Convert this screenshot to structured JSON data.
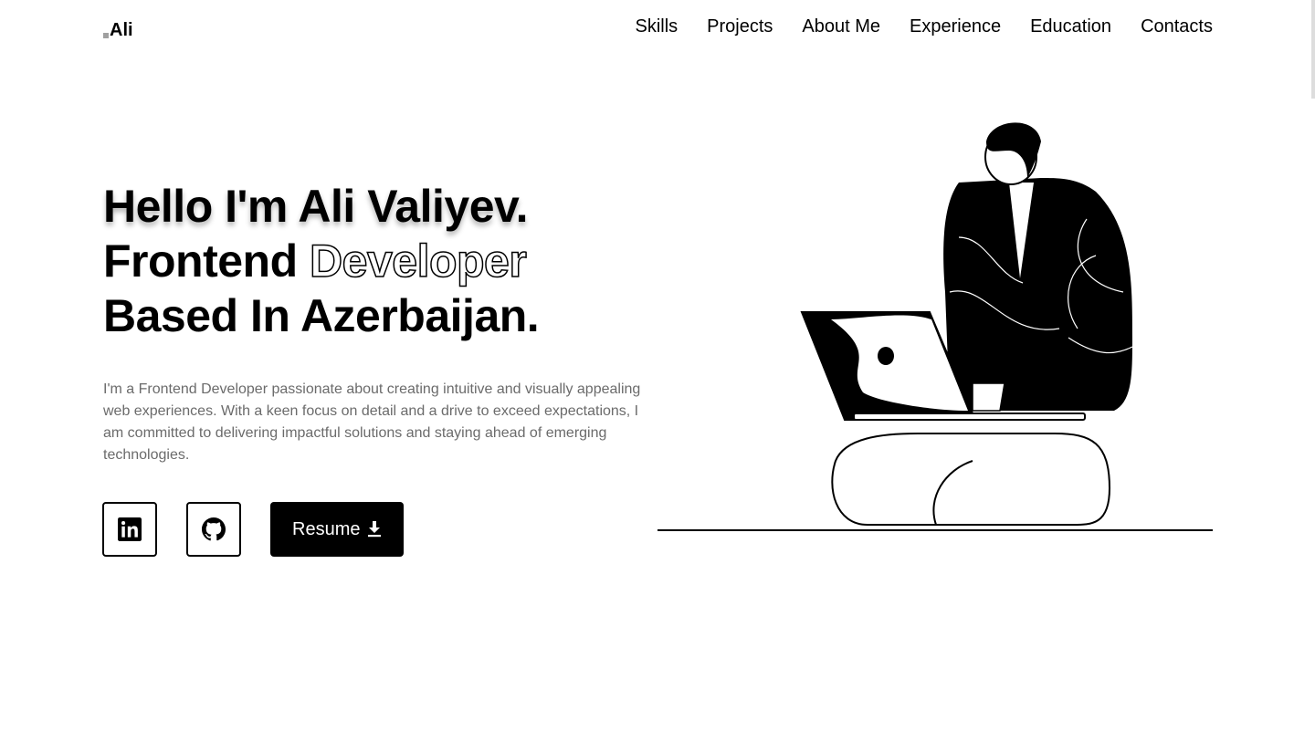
{
  "logo": {
    "text": "Ali"
  },
  "nav": [
    "Skills",
    "Projects",
    "About Me",
    "Experience",
    "Education",
    "Contacts"
  ],
  "hero": {
    "l1a": "Hello I'm ",
    "l1b": "Ali Valiyev.",
    "l2a": "Frontend ",
    "l2b": "Developer",
    "l3a": "Based In ",
    "l3b": "Azerbaijan."
  },
  "description": "I'm a Frontend Developer passionate about creating intuitive and visually appealing web experiences. With a keen focus on detail and a drive to exceed expectations, I am committed to delivering impactful solutions and staying ahead of emerging technologies.",
  "buttons": {
    "linkedin_icon": "linkedin-icon",
    "github_icon": "github-icon",
    "resume": "Resume",
    "resume_icon": "download-icon"
  }
}
